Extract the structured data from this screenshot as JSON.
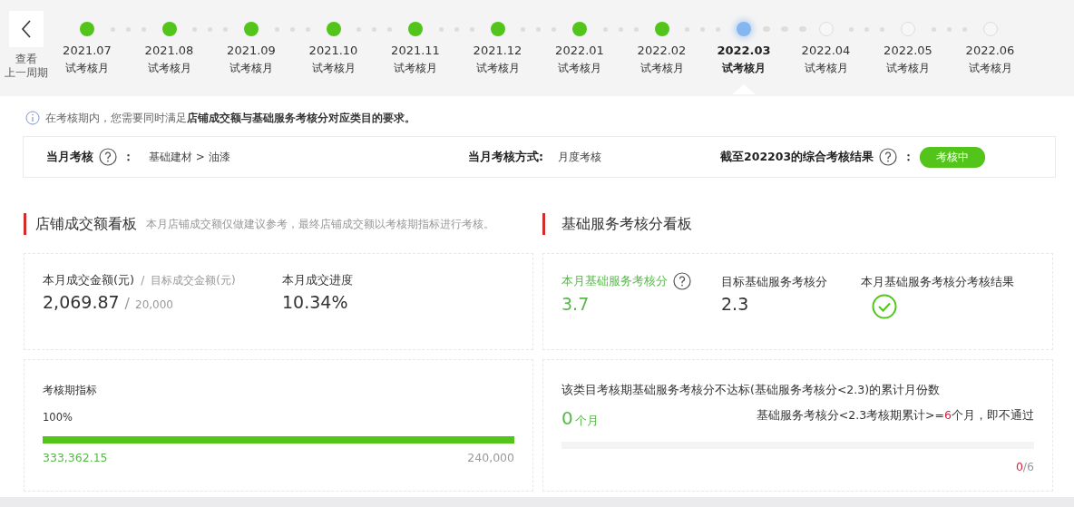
{
  "timeline": {
    "back_button": {
      "label_1": "查看",
      "label_2": "上一周期"
    },
    "steps": [
      {
        "date": "2021.07",
        "label": "试考核月",
        "kind": "done",
        "selected": false
      },
      {
        "date": "2021.08",
        "label": "试考核月",
        "kind": "done",
        "selected": false
      },
      {
        "date": "2021.09",
        "label": "试考核月",
        "kind": "done",
        "selected": false
      },
      {
        "date": "2021.10",
        "label": "试考核月",
        "kind": "done",
        "selected": false
      },
      {
        "date": "2021.11",
        "label": "试考核月",
        "kind": "done",
        "selected": false
      },
      {
        "date": "2021.12",
        "label": "试考核月",
        "kind": "done",
        "selected": false
      },
      {
        "date": "2022.01",
        "label": "试考核月",
        "kind": "done",
        "selected": false
      },
      {
        "date": "2022.02",
        "label": "试考核月",
        "kind": "done",
        "selected": false
      },
      {
        "date": "2022.03",
        "label": "试考核月",
        "kind": "current",
        "selected": true
      },
      {
        "date": "2022.04",
        "label": "试考核月",
        "kind": "upcoming",
        "selected": false
      },
      {
        "date": "2022.05",
        "label": "试考核月",
        "kind": "upcoming",
        "selected": false
      },
      {
        "date": "2022.06",
        "label": "试考核月",
        "kind": "upcoming",
        "selected": false
      }
    ]
  },
  "notice": "在考核期内，您需要同时满足**店铺成交额与基础服务考核分对应类目的要求。**",
  "summary": {
    "category_label": "当月考核",
    "colon_1": "：",
    "category_value": "基础建材 > 油漆",
    "method_label": "当月考核方式:",
    "method_value": "月度考核",
    "result_label": "截至202203的综合考核结果",
    "colon_2": "：",
    "result_badge": "考核中"
  },
  "sales_board": {
    "title": "店铺成交额看板",
    "note": "本月店铺成交额仅做建议参考，最终店铺成交额以考核期指标进行考核。",
    "amount_label": "本月成交金额(元)",
    "slash_1": "/",
    "target_label": "目标成交金额(元)",
    "amount_value": "2,069.87",
    "slash_2": "/",
    "target_value": "20,000",
    "progress_label": "本月成交进度",
    "progress_value": "10.34%",
    "period_label": "考核期指标",
    "period_percent": "100%",
    "level": 1,
    "period_actual": "333,362.15",
    "period_target": "240,000"
  },
  "service_board": {
    "title": "基础服务考核分看板",
    "score_label": "本月基础服务考核分",
    "score_value": "3.7",
    "target_label": "目标基础服务考核分",
    "target_value": "2.3",
    "result_label": "本月基础服务考核分考核结果",
    "passed": true,
    "fail_title": "该类目考核期基础服务考核分不达标(基础服务考核分<2.3)的累计月份数",
    "fail_months": "0",
    "fail_unit": "个月",
    "rule_before": "基础服务考核分<2.3考核期累计>=",
    "rule_count": "6",
    "rule_after": "个月，即不通过",
    "level": 0,
    "fail_count": "0",
    "fail_total": "/6"
  }
}
